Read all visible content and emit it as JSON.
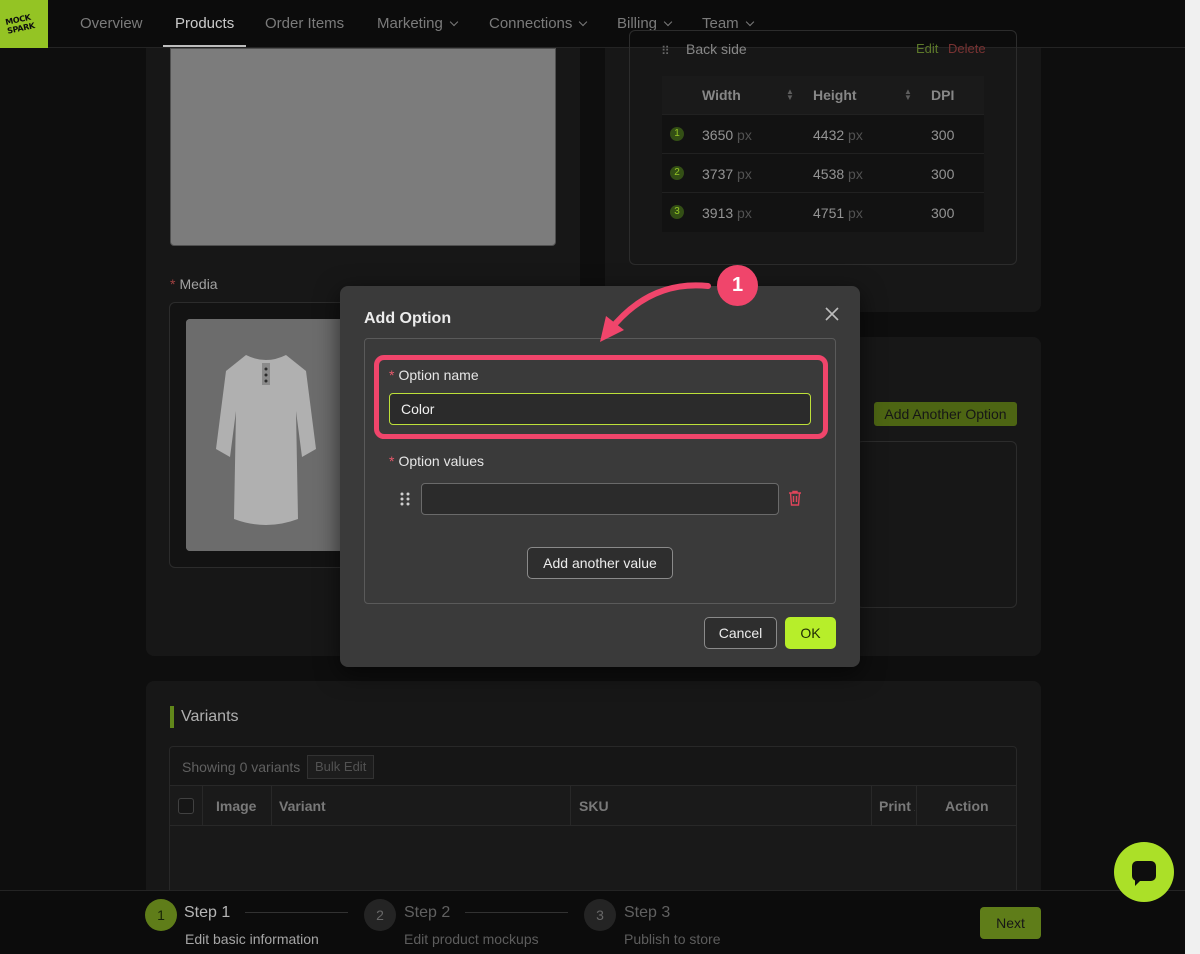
{
  "nav": {
    "logo_text": "MOCK SPARK",
    "items": [
      {
        "label": "Overview"
      },
      {
        "label": "Products"
      },
      {
        "label": "Order Items"
      },
      {
        "label": "Marketing"
      },
      {
        "label": "Connections"
      },
      {
        "label": "Billing"
      },
      {
        "label": "Team"
      }
    ],
    "active": "Products"
  },
  "product": {
    "media_label": "Media",
    "print_area": {
      "side_name": "Back side",
      "edit_label": "Edit",
      "delete_label": "Delete",
      "columns": [
        "Width",
        "Height",
        "DPI"
      ],
      "unit": "px",
      "rows": [
        {
          "n": "1",
          "width": "3650",
          "height": "4432",
          "dpi": "300"
        },
        {
          "n": "2",
          "width": "3737",
          "height": "4538",
          "dpi": "300"
        },
        {
          "n": "3",
          "width": "3913",
          "height": "4751",
          "dpi": "300"
        }
      ]
    },
    "add_another_option_label": "Add Another Option"
  },
  "variants": {
    "title": "Variants",
    "showing": "Showing 0 variants",
    "bulk_edit": "Bulk Edit",
    "columns": {
      "image": "Image",
      "variant": "Variant",
      "sku": "SKU",
      "print": "Print A",
      "action": "Action"
    }
  },
  "steps": [
    {
      "number": "1",
      "title": "Step 1",
      "desc": "Edit basic information"
    },
    {
      "number": "2",
      "title": "Step 2",
      "desc": "Edit product mockups"
    },
    {
      "number": "3",
      "title": "Step 3",
      "desc": "Publish to store"
    }
  ],
  "next_label": "Next",
  "modal": {
    "title": "Add Option",
    "option_name_label": "Option name",
    "option_name_value": "Color",
    "option_values_label": "Option values",
    "option_value_input": "",
    "add_value_label": "Add another value",
    "cancel_label": "Cancel",
    "ok_label": "OK"
  },
  "annotation": {
    "badge": "1",
    "color": "#f0456b"
  },
  "colors": {
    "accent": "#b7ee2a",
    "background": "#101010"
  }
}
